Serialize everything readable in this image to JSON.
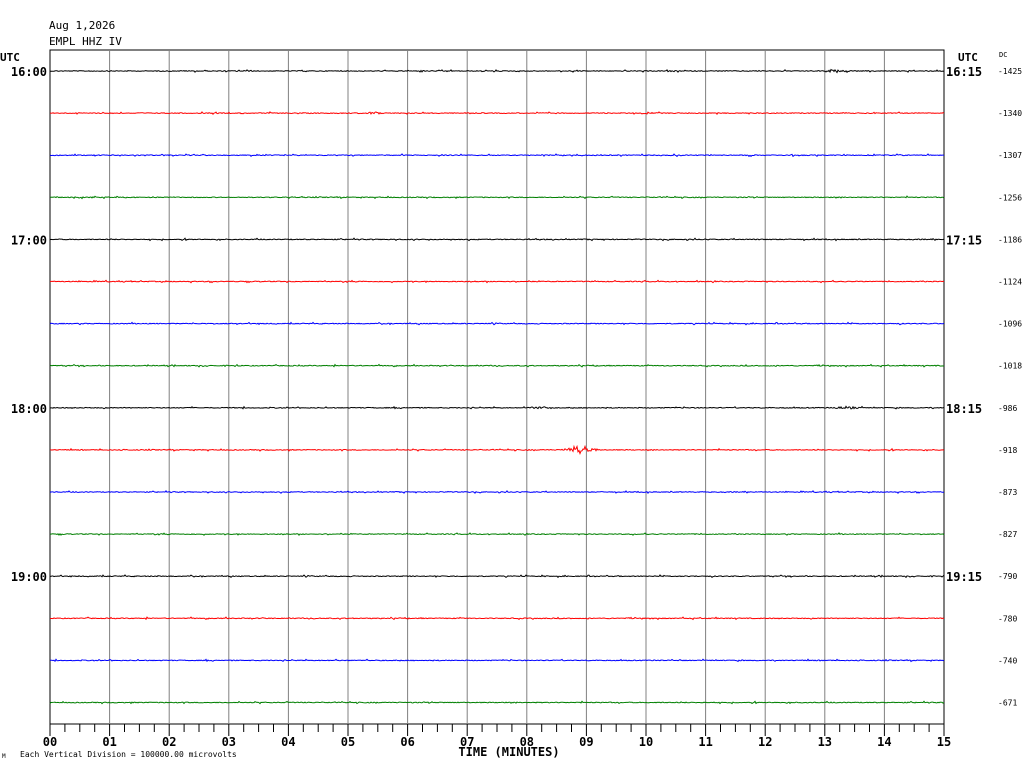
{
  "header": {
    "date": "Aug 1,2026",
    "station": "EMPL HHZ IV"
  },
  "footer": {
    "vertical_division": "Each Vertical Division = 100000.00 microvolts",
    "corner_mark": "M"
  },
  "chart_data": {
    "type": "line",
    "title": "",
    "xlabel": "TIME (MINUTES)",
    "left_axis_label": "UTC",
    "right_axis_label": "UTC",
    "dc_label": "DC",
    "xlim": [
      0,
      15
    ],
    "x_tick_labels": [
      "00",
      "01",
      "02",
      "03",
      "04",
      "05",
      "06",
      "07",
      "08",
      "09",
      "10",
      "11",
      "12",
      "13",
      "14",
      "15"
    ],
    "grid": true,
    "trace_colors": [
      "#000000",
      "#ff0000",
      "#0000ff",
      "#007f00"
    ],
    "traces": [
      {
        "left_label": "16:00",
        "right_label": "16:15",
        "dc": "-1425",
        "color": "#000000"
      },
      {
        "left_label": "",
        "right_label": "",
        "dc": "-1340",
        "color": "#ff0000"
      },
      {
        "left_label": "",
        "right_label": "",
        "dc": "-1307",
        "color": "#0000ff"
      },
      {
        "left_label": "",
        "right_label": "",
        "dc": "-1256",
        "color": "#007f00"
      },
      {
        "left_label": "17:00",
        "right_label": "17:15",
        "dc": "-1186",
        "color": "#000000"
      },
      {
        "left_label": "",
        "right_label": "",
        "dc": "-1124",
        "color": "#ff0000"
      },
      {
        "left_label": "",
        "right_label": "",
        "dc": "-1096",
        "color": "#0000ff"
      },
      {
        "left_label": "",
        "right_label": "",
        "dc": "-1018",
        "color": "#007f00"
      },
      {
        "left_label": "18:00",
        "right_label": "18:15",
        "dc": "-986",
        "color": "#000000"
      },
      {
        "left_label": "",
        "right_label": "",
        "dc": "-918",
        "color": "#ff0000"
      },
      {
        "left_label": "",
        "right_label": "",
        "dc": "-873",
        "color": "#0000ff"
      },
      {
        "left_label": "",
        "right_label": "",
        "dc": "-827",
        "color": "#007f00"
      },
      {
        "left_label": "19:00",
        "right_label": "19:15",
        "dc": "-790",
        "color": "#000000"
      },
      {
        "left_label": "",
        "right_label": "",
        "dc": "-780",
        "color": "#ff0000"
      },
      {
        "left_label": "",
        "right_label": "",
        "dc": "-740",
        "color": "#0000ff"
      },
      {
        "left_label": "",
        "right_label": "",
        "dc": "-671",
        "color": "#007f00"
      }
    ],
    "events": [
      {
        "trace": 9,
        "minute": 8.9,
        "amplitude": "moderate"
      },
      {
        "trace": 0,
        "minute": 13.2,
        "amplitude": "small"
      },
      {
        "trace": 8,
        "minute": 13.4,
        "amplitude": "small"
      },
      {
        "trace": 8,
        "minute": 8.2,
        "amplitude": "small"
      },
      {
        "trace": 1,
        "minute": 5.4,
        "amplitude": "small"
      }
    ]
  }
}
